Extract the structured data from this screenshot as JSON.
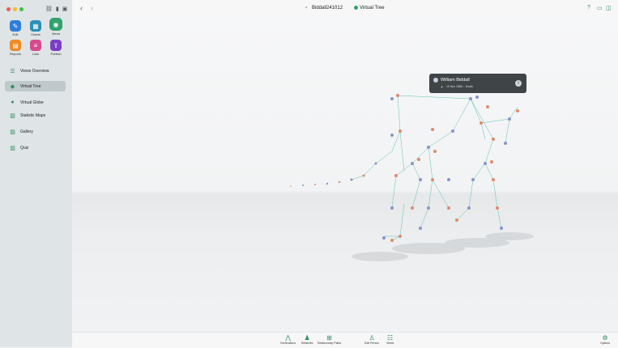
{
  "window": {
    "title": "Biddall241012",
    "view_title": "Virtual Tree"
  },
  "sidebar": {
    "top_buttons": [
      {
        "label": "Edit",
        "icon": "pencil-icon",
        "color": "#2f7ed8"
      },
      {
        "label": "Charts",
        "icon": "charts-icon",
        "color": "#2a8fb8"
      },
      {
        "label": "Views",
        "icon": "eye-icon",
        "color": "#2fa36b"
      },
      {
        "label": "Reports",
        "icon": "report-icon",
        "color": "#f08a24"
      },
      {
        "label": "Lists",
        "icon": "list-icon",
        "color": "#d64b8f"
      },
      {
        "label": "Publish",
        "icon": "publish-icon",
        "color": "#7b3fc4"
      }
    ],
    "nav": [
      {
        "label": "Views Overview",
        "icon": "list-grid-icon"
      },
      {
        "label": "Virtual Tree",
        "icon": "cube-icon"
      },
      {
        "label": "Virtual Globe",
        "icon": "globe-icon"
      },
      {
        "label": "Statistic Maps",
        "icon": "map-icon"
      },
      {
        "label": "Gallery",
        "icon": "gallery-icon"
      },
      {
        "label": "Quiz",
        "icon": "quiz-icon"
      }
    ]
  },
  "tooltip": {
    "name": "William Biddall",
    "detail": "10 Nov 1586 – Death"
  },
  "bottom_bar": [
    {
      "label": "Generations",
      "icon": "generations-icon"
    },
    {
      "label": "Relatives",
      "icon": "relatives-icon"
    },
    {
      "label": "Relationship Paths",
      "icon": "relationship-paths-icon"
    },
    {
      "label": "Edit Person",
      "icon": "edit-person-icon"
    },
    {
      "label": "Views",
      "icon": "views-icon"
    },
    {
      "label": "Options",
      "icon": "options-icon"
    }
  ],
  "colors": {
    "accent": "#2f8b5d",
    "male": "#8a93c9",
    "female": "#e08a6a",
    "line": "#5cc1b3"
  }
}
